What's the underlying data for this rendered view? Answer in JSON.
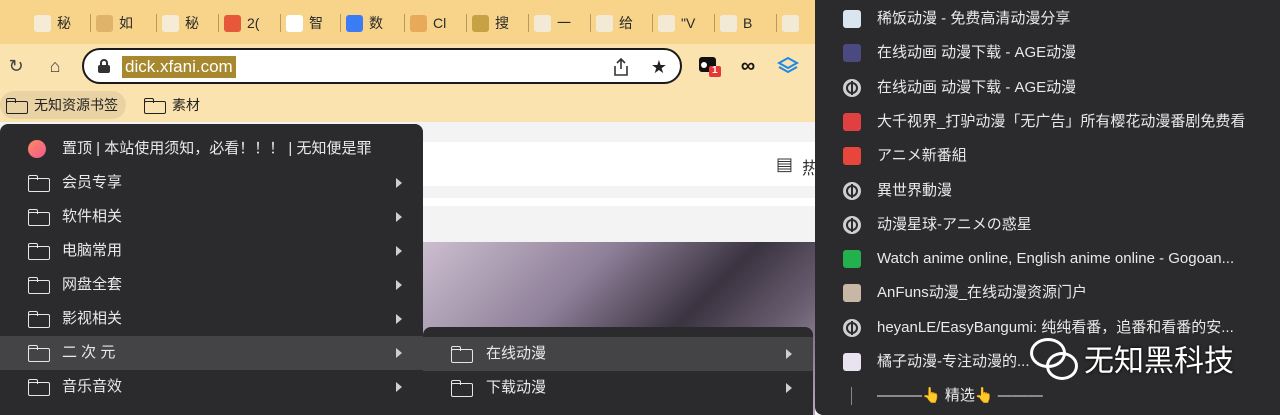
{
  "tabs": [
    {
      "label": "秘",
      "icon": "page-icon",
      "color": "#f4ecd6"
    },
    {
      "label": "如",
      "icon": "pen-icon",
      "color": "#e0b36a"
    },
    {
      "label": "秘",
      "icon": "page-icon",
      "color": "#f4ecd6"
    },
    {
      "label": "2(",
      "icon": "feather-icon",
      "color": "#e5583a"
    },
    {
      "label": "智",
      "icon": "avatar-icon",
      "color": "#ffffff"
    },
    {
      "label": "数",
      "icon": "app-icon",
      "color": "#3b7cf4"
    },
    {
      "label": "Cl",
      "icon": "dog-icon",
      "color": "#e8a95a"
    },
    {
      "label": "搜",
      "icon": "target-icon",
      "color": "#c6a245"
    },
    {
      "label": "一",
      "icon": "rabbit-icon",
      "color": "#f3ead6"
    },
    {
      "label": "给",
      "icon": "cartoon-avatar-icon",
      "color": "#f3ead6"
    },
    {
      "label": "\"V",
      "icon": "cartoon-avatar-icon",
      "color": "#f3ead6"
    },
    {
      "label": "B",
      "icon": "cartoon-avatar-icon",
      "color": "#f3ead6"
    },
    {
      "label": "",
      "icon": "cartoon-avatar-icon",
      "color": "#f3ead6"
    }
  ],
  "address": {
    "url": "dick.xfani.com"
  },
  "extensions": {
    "badge": "1"
  },
  "bookmarks_bar": [
    {
      "label": "无知资源书签"
    },
    {
      "label": "素材"
    }
  ],
  "page": {
    "partial_text": "热"
  },
  "menu_main": [
    {
      "label": "置顶 | 本站使用须知，必看！！！ | 无知便是罪",
      "type": "bookmark"
    },
    {
      "label": "会员专享",
      "type": "folder"
    },
    {
      "label": "软件相关",
      "type": "folder"
    },
    {
      "label": "电脑常用",
      "type": "folder"
    },
    {
      "label": "网盘全套",
      "type": "folder"
    },
    {
      "label": "影视相关",
      "type": "folder"
    },
    {
      "label": "二 次 元",
      "type": "folder",
      "highlighted": true
    },
    {
      "label": "音乐音效",
      "type": "folder"
    }
  ],
  "menu_sub": [
    {
      "label": "在线动漫",
      "highlighted": true
    },
    {
      "label": "下载动漫"
    }
  ],
  "menu_links": [
    {
      "label": "稀饭动漫 - 免费高清动漫分享",
      "icon": "xifan-icon",
      "color": "#d9e6f0"
    },
    {
      "label": "在线动画 动漫下载 - AGE动漫",
      "icon": "age-anime-icon",
      "color": "#4a4a80"
    },
    {
      "label": "在线动画 动漫下载 - AGE动漫",
      "icon": "globe-icon",
      "color": "#cfcfcf"
    },
    {
      "label": "大千视界_打驴动漫「无广告」所有樱花动漫番剧免费看",
      "icon": "bars-icon",
      "color": "#e04040"
    },
    {
      "label": "アニメ新番組",
      "icon": "tv-icon",
      "color": "#e8453c"
    },
    {
      "label": "異世界動漫",
      "icon": "globe-icon",
      "color": "#cfcfcf"
    },
    {
      "label": "动漫星球-アニメの惑星",
      "icon": "globe-icon",
      "color": "#cfcfcf"
    },
    {
      "label": "Watch anime online, English anime online - Gogoan...",
      "icon": "shield-icon",
      "color": "#22b14c"
    },
    {
      "label": "AnFuns动漫_在线动漫资源门户",
      "icon": "anfuns-icon",
      "color": "#c9b7a6"
    },
    {
      "label": "heyanLE/EasyBangumi: 纯纯看番，追番和看番的安...",
      "icon": "globe-icon",
      "color": "#cfcfcf"
    },
    {
      "label": "橘子动漫-专注动漫的...",
      "icon": "orange-icon",
      "color": "#e9e3ef"
    },
    {
      "label": "———👆 精选👆 ———",
      "icon": "separator-line-icon",
      "color": "#2b2b2d"
    }
  ],
  "watermark": {
    "text": "无知黑科技",
    "icon": "wechat-icon"
  }
}
